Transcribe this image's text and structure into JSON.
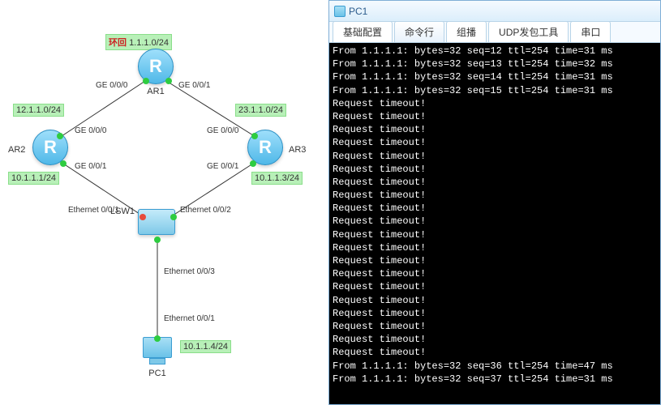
{
  "topology": {
    "loopback_label": "环回",
    "loopback_net": "1.1.1.0/24",
    "devices": {
      "ar1": "AR1",
      "ar2": "AR2",
      "ar3": "AR3",
      "lsw1": "LSW1",
      "pc1": "PC1"
    },
    "nets": {
      "ar1_ar2": "12.1.1.0/24",
      "ar1_ar3": "23.1.1.0/24",
      "ar2_ip": "10.1.1.1/24",
      "ar3_ip": "10.1.1.3/24",
      "pc1_ip": "10.1.1.4/24"
    },
    "ports": {
      "ar1_left": "GE 0/0/0",
      "ar1_right": "GE 0/0/1",
      "ar2_top": "GE 0/0/0",
      "ar2_bot": "GE 0/0/1",
      "ar3_top": "GE 0/0/0",
      "ar3_bot": "GE 0/0/1",
      "lsw1_left": "Ethernet 0/0/1",
      "lsw1_right": "Ethernet 0/0/2",
      "lsw1_bot": "Ethernet 0/0/3",
      "pc1_top": "Ethernet 0/0/1"
    }
  },
  "terminal": {
    "title": "PC1",
    "tabs": [
      "基础配置",
      "命令行",
      "组播",
      "UDP发包工具",
      "串口"
    ],
    "active_tab": 1,
    "lines": [
      "From 1.1.1.1: bytes=32 seq=12 ttl=254 time=31 ms",
      "From 1.1.1.1: bytes=32 seq=13 ttl=254 time=32 ms",
      "From 1.1.1.1: bytes=32 seq=14 ttl=254 time=31 ms",
      "From 1.1.1.1: bytes=32 seq=15 ttl=254 time=31 ms",
      "Request timeout!",
      "Request timeout!",
      "Request timeout!",
      "Request timeout!",
      "Request timeout!",
      "Request timeout!",
      "Request timeout!",
      "Request timeout!",
      "Request timeout!",
      "Request timeout!",
      "Request timeout!",
      "Request timeout!",
      "Request timeout!",
      "Request timeout!",
      "Request timeout!",
      "Request timeout!",
      "Request timeout!",
      "Request timeout!",
      "Request timeout!",
      "Request timeout!",
      "From 1.1.1.1: bytes=32 seq=36 ttl=254 time=47 ms",
      "From 1.1.1.1: bytes=32 seq=37 ttl=254 time=31 ms"
    ]
  }
}
